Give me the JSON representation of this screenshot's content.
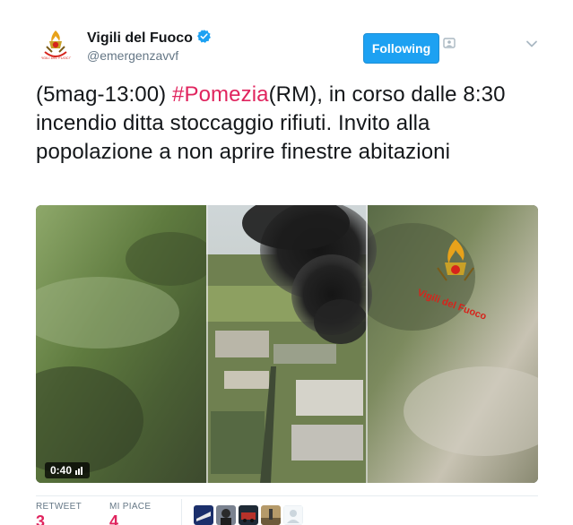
{
  "user": {
    "name": "Vigili del Fuoco",
    "handle": "@emergenzavvf",
    "verified": true
  },
  "follow_button": {
    "label": "Following"
  },
  "tweet": {
    "prefix": "(5mag-13:00) ",
    "hashtag": "#Pomezia",
    "suffix": "(RM), in corso dalle 8:30 incendio ditta stoccaggio rifiuti. Invito alla popolazione a non aprire finestre abitazioni"
  },
  "media": {
    "duration": "0:40",
    "watermark": "Vigili del Fuoco"
  },
  "stats": {
    "retweet_label": "RETWEET",
    "retweet_count": "3",
    "likes_label": "MI PIACE",
    "likes_count": "4"
  },
  "colors": {
    "accent": "#1da1f2",
    "hashtag": "#e0245e",
    "muted": "#657786",
    "divider": "#e6ecf0"
  },
  "icons": {
    "verified": "verified-badge-icon",
    "block": "block-user-icon",
    "chevron": "chevron-down-icon",
    "duration": "video-bars-icon"
  }
}
